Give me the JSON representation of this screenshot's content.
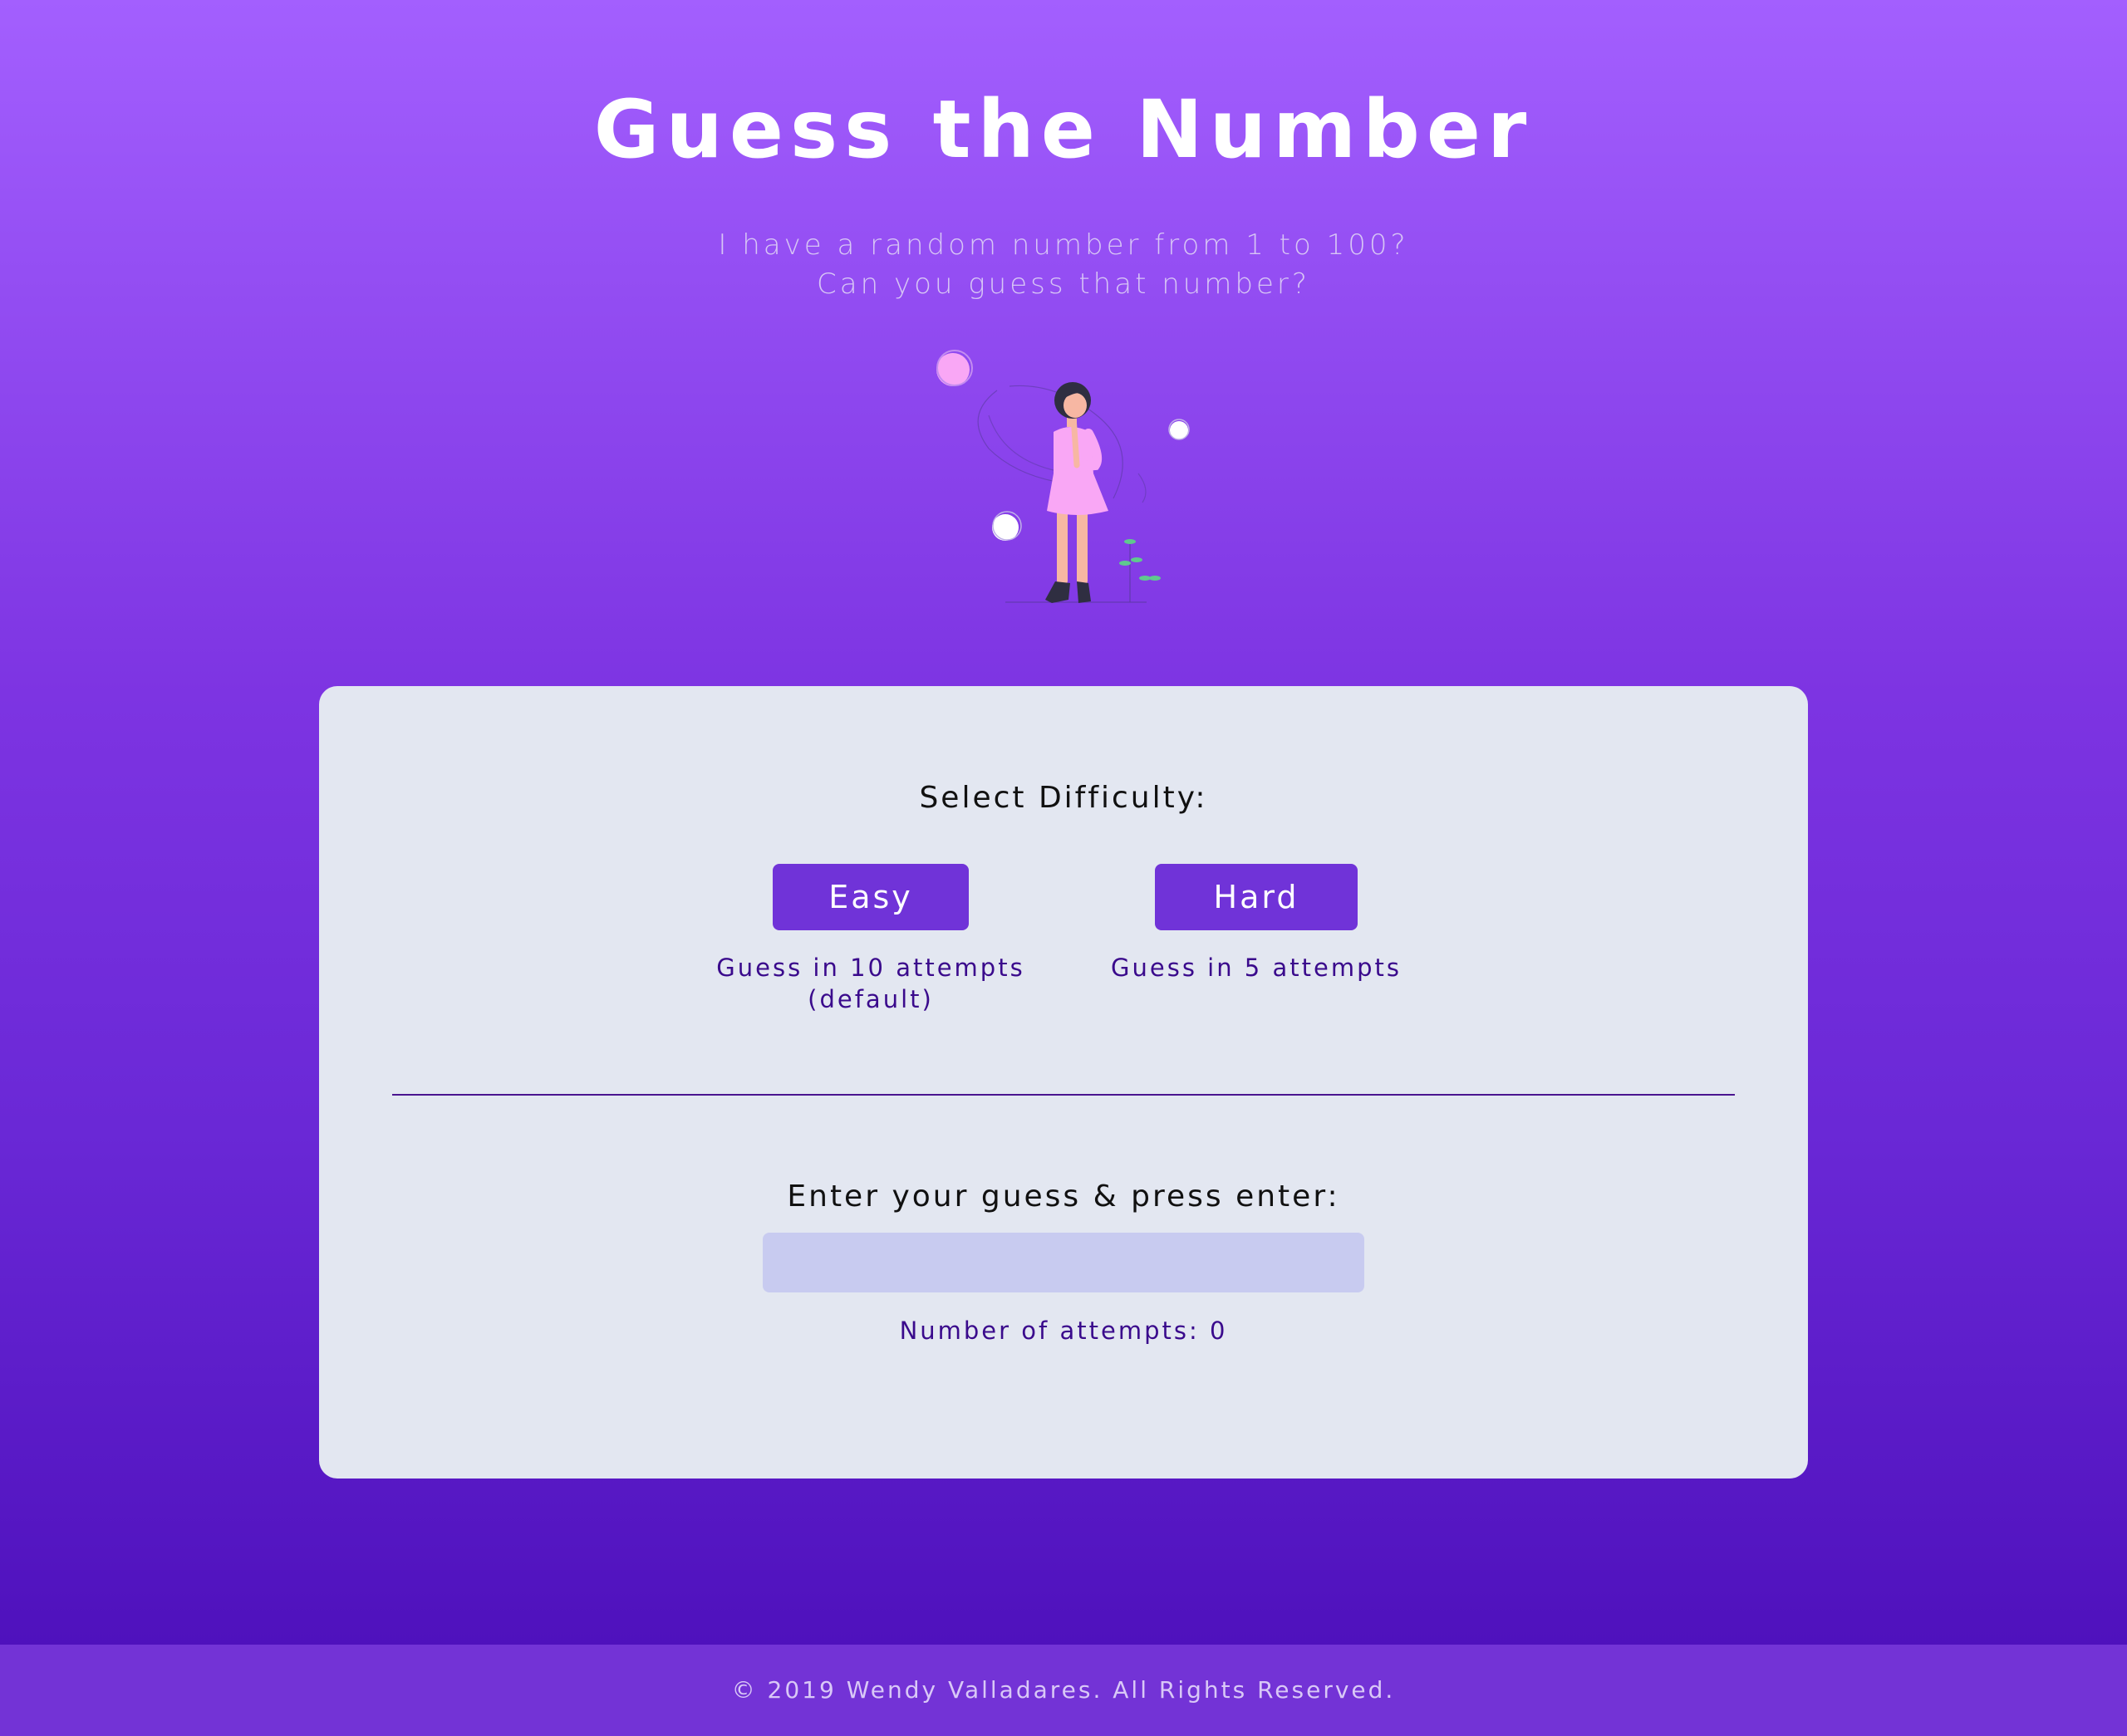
{
  "header": {
    "title": "Guess the Number",
    "subtitle_line1": "I have a random number from 1 to 100?",
    "subtitle_line2": "Can you guess that number?"
  },
  "illustration": {
    "icon": "woman-thinking-illustration",
    "colors": {
      "dress": "#f9a7f5",
      "skin": "#f7b7a3",
      "hair": "#2f2e41",
      "plant": "#5fc98e",
      "bubble_pink": "#f9a7f5",
      "bubble_white": "#ffffff"
    }
  },
  "game": {
    "difficulty_label": "Select Difficulty:",
    "easy": {
      "label": "Easy",
      "description_line1": "Guess in 10 attempts",
      "description_line2": "(default)"
    },
    "hard": {
      "label": "Hard",
      "description": "Guess in 5 attempts"
    },
    "guess_label": "Enter your guess & press enter:",
    "guess_value": "",
    "guess_placeholder": "",
    "attempts_text": "Number of attempts: 0"
  },
  "footer": {
    "text": "© 2019 Wendy Valladares. All Rights Reserved."
  },
  "colors": {
    "background_top": "#a35ffe",
    "background_bottom": "#4a0db8",
    "card": "#e3e7f1",
    "button": "#7033d8",
    "accent_text": "#3a0a8c",
    "input": "#c8cbf0",
    "footer": "#7333d6"
  }
}
